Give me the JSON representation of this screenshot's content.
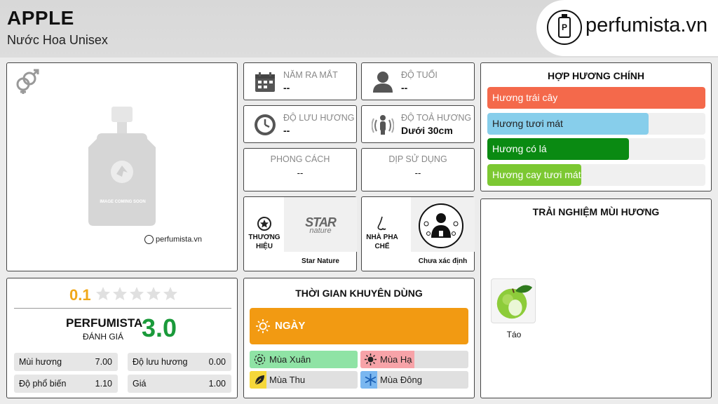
{
  "header": {
    "title": "APPLE",
    "subtitle": "Nước Hoa Unisex"
  },
  "logo": {
    "text": "perfumista.vn",
    "mark": "P"
  },
  "product_image": {
    "caption": "IMAGE COMING SOON",
    "watermark": "perfumista.vn"
  },
  "info": {
    "release_year": {
      "label": "NĂM RA MẮT",
      "value": "--"
    },
    "age": {
      "label": "ĐỘ TUỔI",
      "value": "--"
    },
    "longevity": {
      "label": "ĐỘ LƯU HƯƠNG",
      "value": "--"
    },
    "sillage": {
      "label": "ĐỘ TOẢ HƯƠNG",
      "value": "Dưới 30cm"
    },
    "style": {
      "label": "PHONG CÁCH",
      "value": "--"
    },
    "occasion": {
      "label": "DỊP SỬ DỤNG",
      "value": "--"
    }
  },
  "brand": {
    "label_line1": "THƯƠNG",
    "label_line2": "HIỆU",
    "logo_line1": "STAR",
    "logo_line2": "nature",
    "name": "Star Nature"
  },
  "perfumer": {
    "label_line1": "NHÀ PHA",
    "label_line2": "CHẾ",
    "name": "Chưa xác định"
  },
  "accords": {
    "title": "HỢP HƯƠNG CHÍNH",
    "items": [
      {
        "label": "Hương trái cây",
        "percent": 100,
        "color": "#f4694b"
      },
      {
        "label": "Hương tươi mát",
        "percent": 74,
        "color": "#87ceeb"
      },
      {
        "label": "Hương có lá",
        "percent": 65,
        "color": "#0a8a12"
      },
      {
        "label": "Hương cay tươi mát",
        "percent": 43,
        "color": "#7cc832"
      }
    ]
  },
  "notes": {
    "title": "TRẢI NGHIỆM MÙI HƯƠNG",
    "items": [
      {
        "label": "Táo"
      }
    ]
  },
  "rating": {
    "user_score": "0.1",
    "stars": 5,
    "star_fill": 0.02,
    "perfumista_label": "PERFUMISTA",
    "perfumista_sub": "ĐÁNH GIÁ",
    "perfumista_score": "3.0",
    "stats": [
      {
        "label": "Mùi hương",
        "value": "7.00"
      },
      {
        "label": "Độ lưu hương",
        "value": "0.00"
      },
      {
        "label": "Độ phổ biến",
        "value": "1.10"
      },
      {
        "label": "Giá",
        "value": "1.00"
      }
    ]
  },
  "usage": {
    "title": "THỜI GIAN KHUYÊN DÙNG",
    "day_label": "NGÀY",
    "day_percent": 100,
    "seasons": [
      {
        "label": "Mùa Xuân",
        "percent": 100,
        "color": "#8fe3a5",
        "icon": "flower-icon"
      },
      {
        "label": "Mùa Hạ",
        "percent": 50,
        "color": "#f7a3a8",
        "icon": "sun-icon"
      },
      {
        "label": "Mùa Thu",
        "percent": 5,
        "color": "#f5d73a",
        "icon": "leaf-icon"
      },
      {
        "label": "Mùa Đông",
        "percent": 5,
        "color": "#7ab7f0",
        "icon": "snowflake-icon"
      }
    ]
  }
}
